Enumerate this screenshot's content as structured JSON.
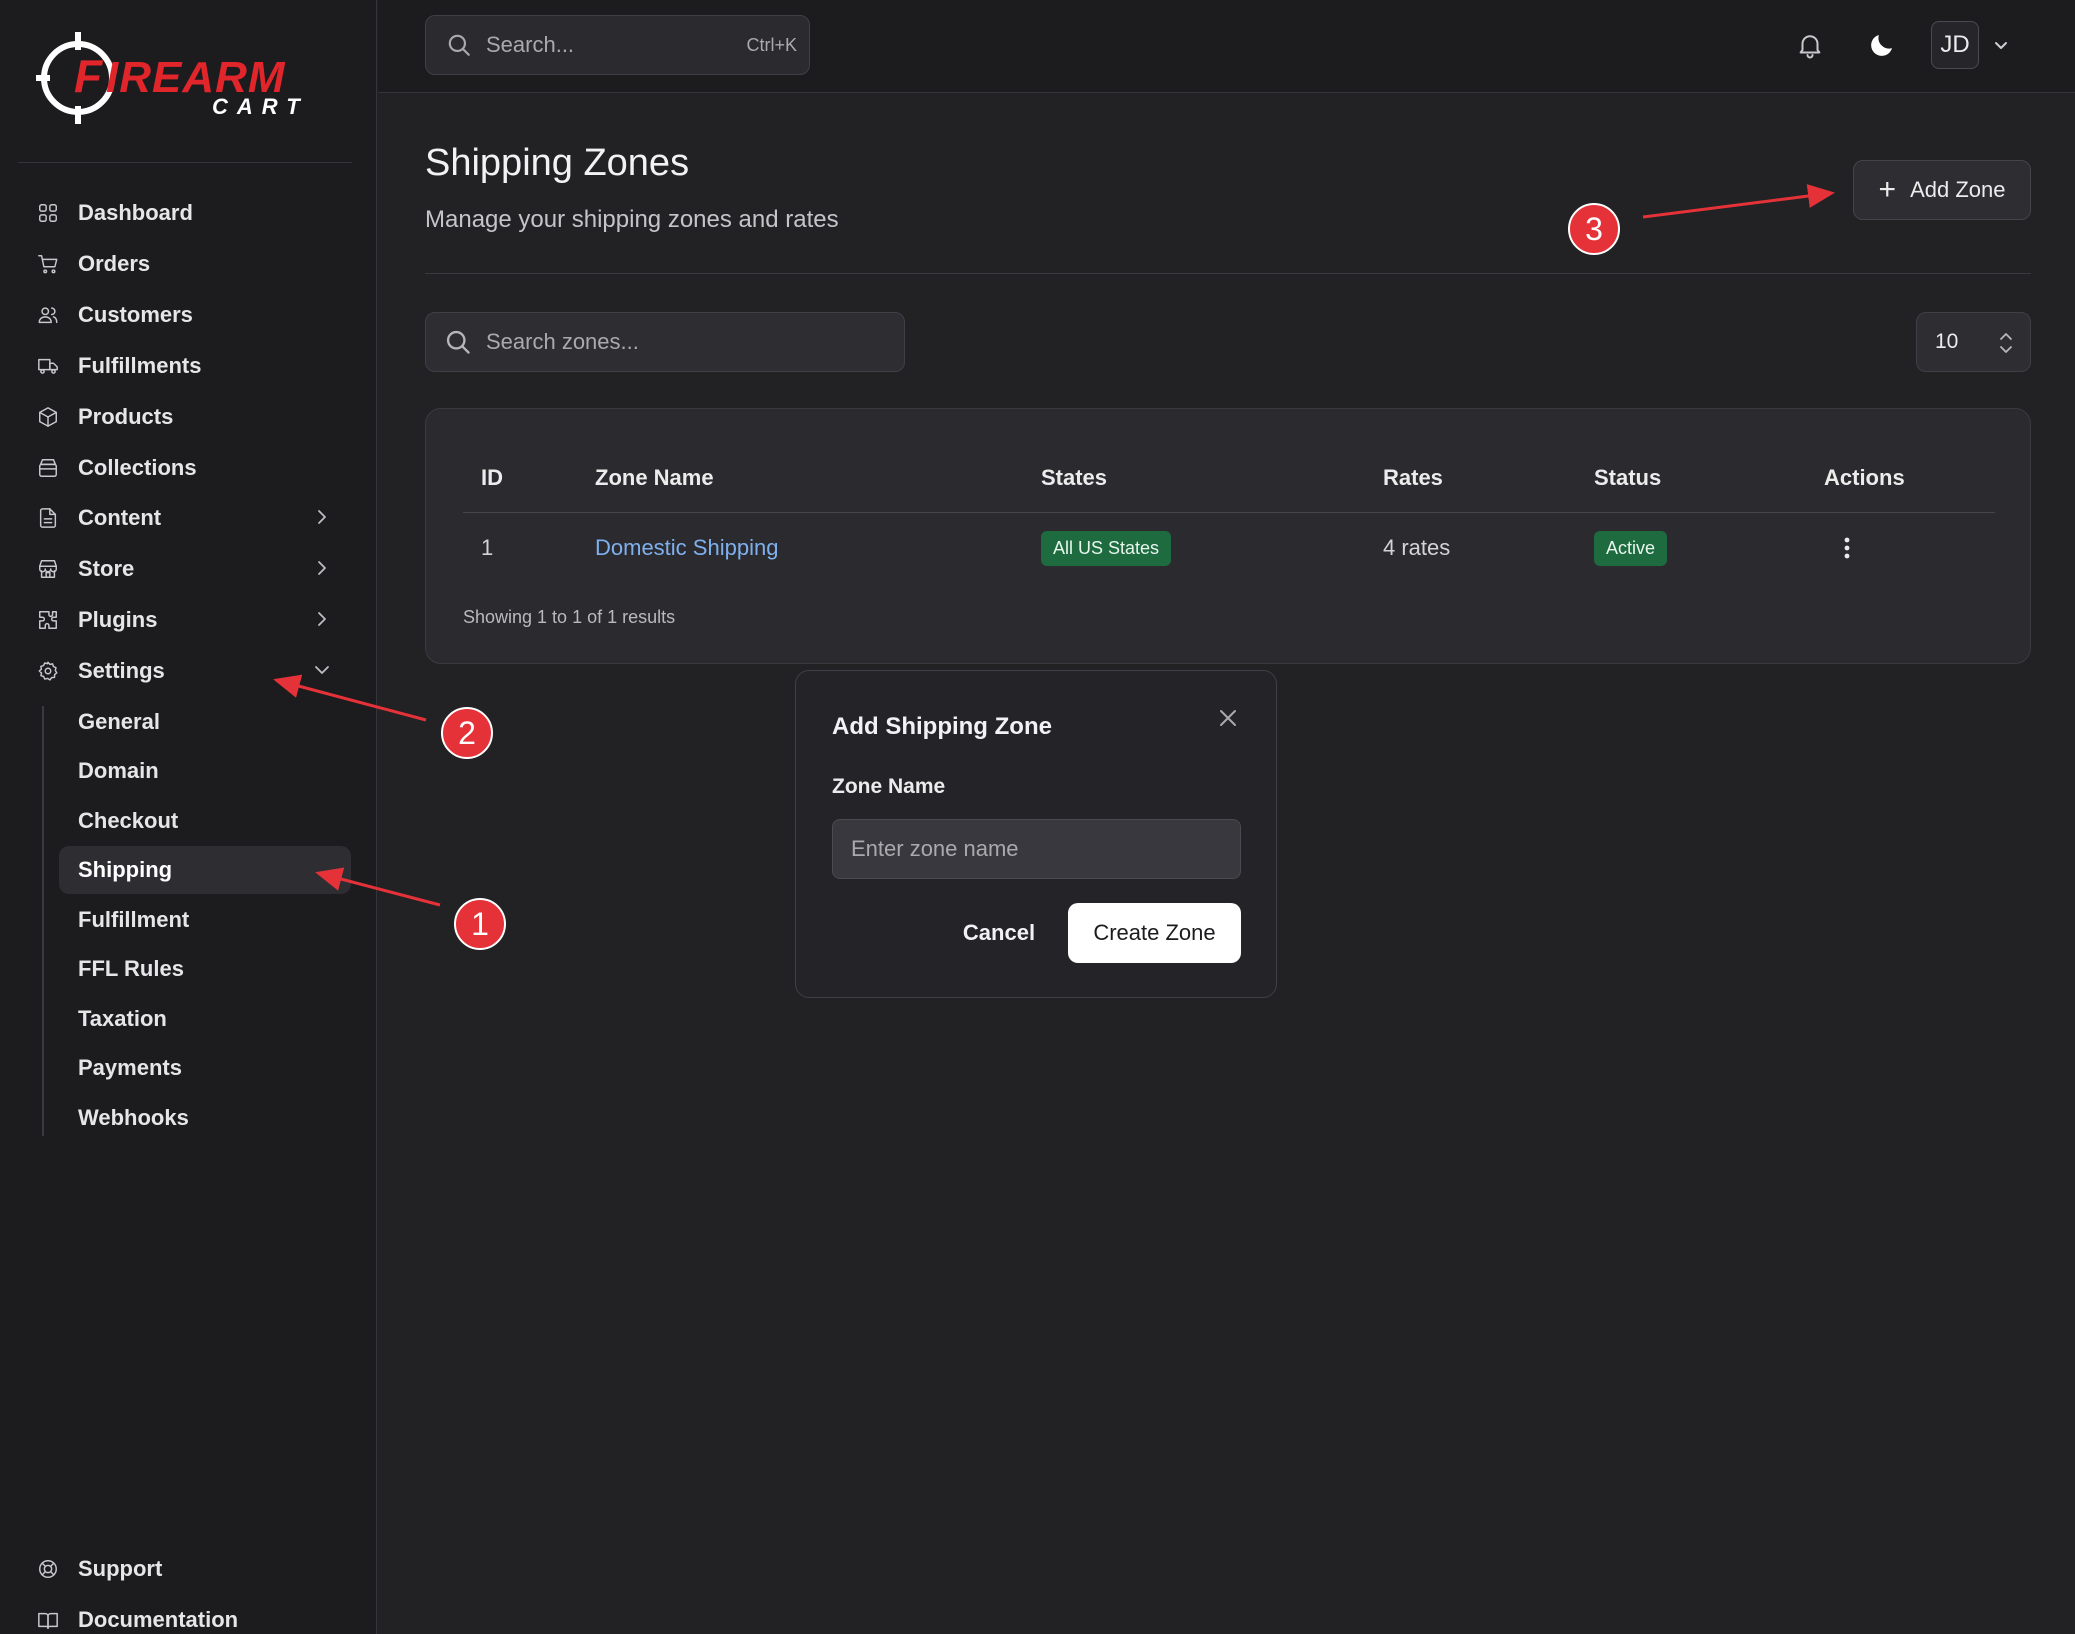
{
  "brand": {
    "logo_text_top": "FIREARM",
    "logo_text_bottom": "CART",
    "accent_color": "#e0252b"
  },
  "sidebar": {
    "items": [
      {
        "label": "Dashboard",
        "icon": "grid-icon"
      },
      {
        "label": "Orders",
        "icon": "cart-icon"
      },
      {
        "label": "Customers",
        "icon": "users-icon"
      },
      {
        "label": "Fulfillments",
        "icon": "truck-icon"
      },
      {
        "label": "Products",
        "icon": "box-icon"
      },
      {
        "label": "Collections",
        "icon": "archive-icon"
      },
      {
        "label": "Content",
        "icon": "file-icon",
        "expandable": true
      },
      {
        "label": "Store",
        "icon": "store-icon",
        "expandable": true
      },
      {
        "label": "Plugins",
        "icon": "puzzle-icon",
        "expandable": true
      },
      {
        "label": "Settings",
        "icon": "gear-icon",
        "expandable": true,
        "expanded": true
      }
    ],
    "settings_sub": [
      {
        "label": "General"
      },
      {
        "label": "Domain"
      },
      {
        "label": "Checkout"
      },
      {
        "label": "Shipping",
        "active": true
      },
      {
        "label": "Fulfillment"
      },
      {
        "label": "FFL Rules"
      },
      {
        "label": "Taxation"
      },
      {
        "label": "Payments"
      },
      {
        "label": "Webhooks"
      }
    ],
    "footer": [
      {
        "label": "Support",
        "icon": "lifebuoy-icon"
      },
      {
        "label": "Documentation",
        "icon": "book-icon"
      }
    ]
  },
  "topbar": {
    "search_placeholder": "Search...",
    "search_shortcut": "Ctrl+K",
    "avatar_initials": "JD"
  },
  "page": {
    "title": "Shipping Zones",
    "subtitle": "Manage your shipping zones and rates",
    "add_button_label": "Add Zone",
    "zone_search_placeholder": "Search zones...",
    "page_size": "10"
  },
  "table": {
    "headers": {
      "id": "ID",
      "zone_name": "Zone Name",
      "states": "States",
      "rates": "Rates",
      "status": "Status",
      "actions": "Actions"
    },
    "rows": [
      {
        "id": "1",
        "zone_name": "Domestic Shipping",
        "states": "All US States",
        "rates": "4 rates",
        "status": "Active"
      }
    ],
    "results_text": "Showing 1 to 1 of 1 results"
  },
  "modal": {
    "title": "Add Shipping Zone",
    "field_label": "Zone Name",
    "field_placeholder": "Enter zone name",
    "field_value": "",
    "cancel_label": "Cancel",
    "create_label": "Create Zone"
  },
  "annotations": {
    "callout_1": "1",
    "callout_2": "2",
    "callout_3": "3",
    "color": "#e53238"
  }
}
